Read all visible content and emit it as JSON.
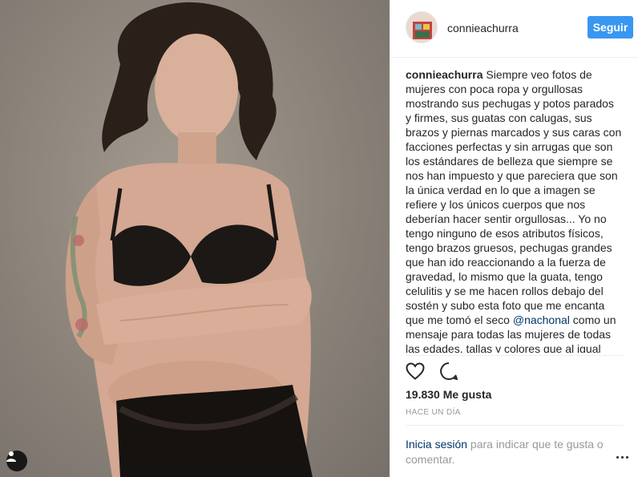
{
  "post": {
    "photo_alt": "Mujer en lencería negra con los brazos cruzados",
    "username": "connieachurra",
    "follow_label": "Seguir",
    "caption_user": "connieachurra",
    "caption_part1": "Siempre veo fotos de mujeres con poca ropa y orgullosas mostrando sus pechugas y potos parados y firmes, sus guatas con calugas, sus brazos y piernas marcados y sus caras con facciones perfectas y sin arrugas que son los estándares de belleza que siempre se nos han impuesto y que pareciera que son la única verdad en lo que a imagen se refiere y los únicos cuerpos que nos deberían hacer sentir orgullosas... Yo no tengo ninguno de esos atributos físicos, tengo brazos gruesos, pechugas grandes que han ido reaccionando a la fuerza de gravedad, lo mismo que la guata, tengo celulitis y se me hacen rollos debajo del sostén y subo esta foto que me encanta que me tomó el seco ",
    "mention": "@nachonal",
    "caption_part2": " como un mensaje para todas las mujeres de todas las edades, tallas y colores que al igual que yo no",
    "likes": "19.830 Me gusta",
    "timestamp": "HACE UN DÍA",
    "login_link": "Inicia sesión",
    "login_text": " para indicar que te gusta o comentar."
  },
  "icons": {
    "like": "heart-icon",
    "comment": "comment-icon",
    "more": "more-options-icon",
    "tag": "user-tag-icon"
  },
  "colors": {
    "follow_button": "#3897f0",
    "link": "#003569",
    "muted": "#999999"
  }
}
